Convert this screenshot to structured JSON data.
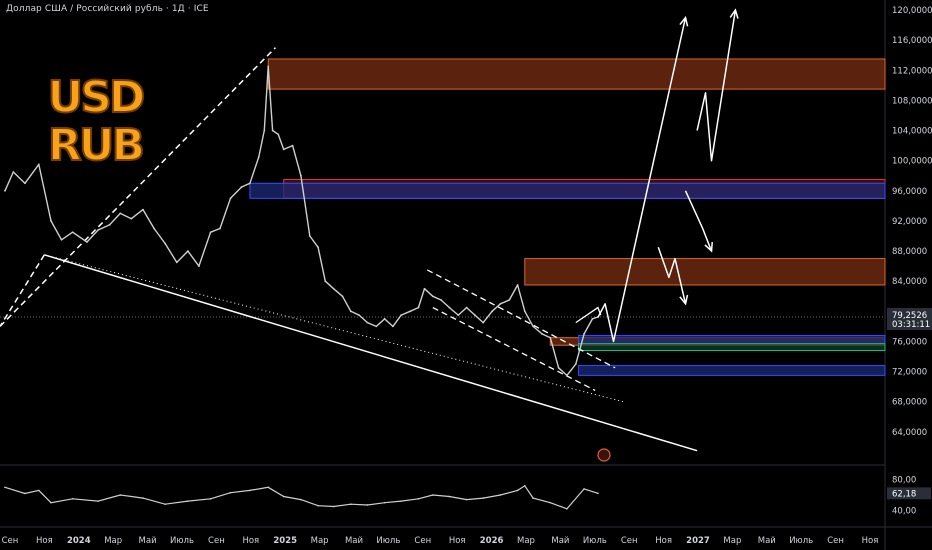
{
  "title": "Доллар США / Российский рубль · 1Д · ICE",
  "logo": {
    "line1": "USD",
    "line2": "RUB"
  },
  "price_tag": {
    "value": "79,2526",
    "countdown": "03:31:11",
    "color": "#2a2e39"
  },
  "colors": {
    "price": "#cfcfcf",
    "resistance_fill": "#7a2e12",
    "resistance_line": "#e0662b",
    "red_fill": "#5a0d12",
    "red_line": "#d33a3a",
    "blue_fill": "#1c2a78",
    "blue_line": "#3050ff",
    "green_fill": "#0e3d2a",
    "green_line": "#18c27a",
    "logo_fill": "#f7a21b"
  },
  "chart_data": [
    {
      "type": "line",
      "name_hint": "main",
      "x": [
        "2023-08-10",
        "2023-08-25",
        "2023-09-15",
        "2023-10-10",
        "2023-11-01",
        "2023-11-20",
        "2023-12-10",
        "2024-01-05",
        "2024-01-25",
        "2024-02-15",
        "2024-03-05",
        "2024-03-25",
        "2024-04-15",
        "2024-05-05",
        "2024-05-25",
        "2024-06-15",
        "2024-07-05",
        "2024-07-25",
        "2024-08-15",
        "2024-09-01",
        "2024-09-20",
        "2024-10-10",
        "2024-10-25",
        "2024-11-10",
        "2024-11-20",
        "2024-11-27",
        "2024-12-05",
        "2024-12-15",
        "2024-12-25",
        "2025-01-10",
        "2025-01-25",
        "2025-02-10",
        "2025-02-25",
        "2025-03-10",
        "2025-03-25",
        "2025-04-10",
        "2025-04-25",
        "2025-05-10",
        "2025-05-25",
        "2025-06-10",
        "2025-06-25",
        "2025-07-10",
        "2025-07-25",
        "2025-08-10",
        "2025-08-25",
        "2025-09-05",
        "2025-09-20",
        "2025-10-05",
        "2025-10-20",
        "2025-11-05",
        "2025-11-20",
        "2025-12-05",
        "2025-12-20",
        "2026-01-05",
        "2026-01-20",
        "2026-02-05",
        "2026-02-20",
        "2026-03-05",
        "2026-03-20",
        "2026-04-05",
        "2026-04-20",
        "2026-05-05",
        "2026-05-20",
        "2026-06-05",
        "2026-06-20",
        "2026-07-05",
        "2026-07-15"
      ],
      "y": [
        96.0,
        98.5,
        97.0,
        99.5,
        92.0,
        89.5,
        90.5,
        89.2,
        90.8,
        91.5,
        93.0,
        92.3,
        93.5,
        91.0,
        89.0,
        86.5,
        88.0,
        86.0,
        90.5,
        91.0,
        95.0,
        96.5,
        97.0,
        100.5,
        104.0,
        112.5,
        104.0,
        103.5,
        101.5,
        102.0,
        98.0,
        90.0,
        88.5,
        84.0,
        83.0,
        82.0,
        80.0,
        79.5,
        78.5,
        78.0,
        79.0,
        78.0,
        79.5,
        80.0,
        80.5,
        83.0,
        82.0,
        81.5,
        80.5,
        79.5,
        80.5,
        79.5,
        78.5,
        80.0,
        81.0,
        81.5,
        83.5,
        80.0,
        78.0,
        77.0,
        76.5,
        72.5,
        71.5,
        73.0,
        77.0,
        79.0,
        79.25
      ],
      "ylim": [
        60,
        120
      ],
      "y_ticks": [
        "120,0000",
        "116,0000",
        "112,0000",
        "108,0000",
        "104,0000",
        "100,0000",
        "96,0000",
        "92,0000",
        "88,0000",
        "84,0000",
        "80,0000",
        "76,0000",
        "72,0000",
        "68,0000",
        "64,0000"
      ],
      "x_tick_labels": [
        "Сен",
        "Ноя",
        "2024",
        "Мар",
        "Май",
        "Июль",
        "Сен",
        "Ноя",
        "2025",
        "Мар",
        "Май",
        "Июль",
        "Сен",
        "Ноя",
        "2026",
        "Мар",
        "Май",
        "Июль",
        "Сен",
        "Ноя",
        "2027",
        "Мар",
        "Май",
        "Июль",
        "Сен",
        "Ноя"
      ]
    },
    {
      "type": "line",
      "name_hint": "oscillator",
      "x": [
        "2023-08-10",
        "2023-09-15",
        "2023-10-10",
        "2023-11-01",
        "2023-12-10",
        "2024-01-25",
        "2024-03-05",
        "2024-04-15",
        "2024-05-25",
        "2024-07-05",
        "2024-08-15",
        "2024-09-20",
        "2024-10-25",
        "2024-11-27",
        "2024-12-25",
        "2025-01-25",
        "2025-02-25",
        "2025-03-25",
        "2025-04-25",
        "2025-05-25",
        "2025-06-25",
        "2025-07-25",
        "2025-08-25",
        "2025-09-20",
        "2025-10-20",
        "2025-11-20",
        "2025-12-20",
        "2026-01-20",
        "2026-02-20",
        "2026-03-05",
        "2026-03-20",
        "2026-04-20",
        "2026-05-20",
        "2026-06-20",
        "2026-07-15"
      ],
      "y": [
        70,
        62,
        66,
        50,
        55,
        52,
        60,
        56,
        48,
        52,
        55,
        63,
        66,
        70,
        58,
        54,
        46,
        45,
        48,
        47,
        50,
        52,
        55,
        60,
        58,
        54,
        56,
        60,
        66,
        72,
        56,
        50,
        42,
        68,
        62.18
      ],
      "ylim": [
        30,
        90
      ],
      "y_ticks": [
        "80,00",
        "40,00"
      ],
      "current": "62,18"
    }
  ]
}
